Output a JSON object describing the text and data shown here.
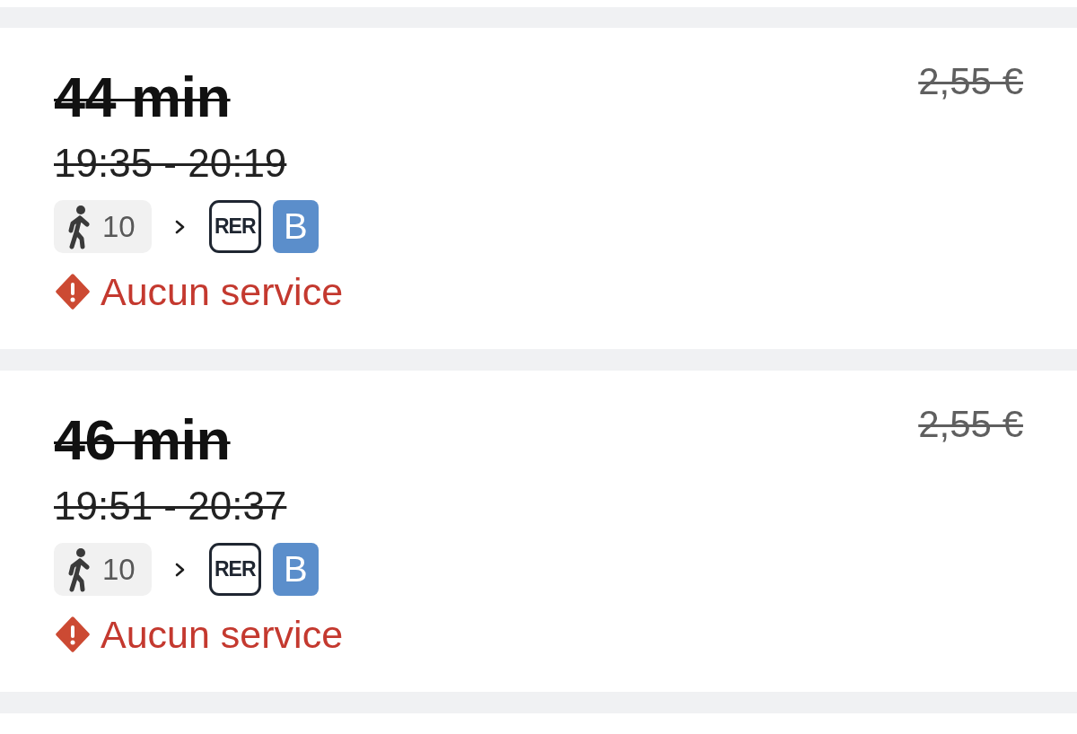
{
  "journeys": [
    {
      "duration": "44 min",
      "times": "19:35 - 20:19",
      "price": "2,55 €",
      "cancelled": true,
      "legs": [
        {
          "kind": "walk",
          "label": "10"
        },
        {
          "kind": "transit",
          "mode": "RER",
          "line": "B",
          "color": "#5b8ecb"
        }
      ],
      "alert": "Aucun service"
    },
    {
      "duration": "46 min",
      "times": "19:51 - 20:37",
      "price": "2,55 €",
      "cancelled": true,
      "legs": [
        {
          "kind": "walk",
          "label": "10"
        },
        {
          "kind": "transit",
          "mode": "RER",
          "line": "B",
          "color": "#5b8ecb"
        }
      ],
      "alert": "Aucun service"
    }
  ]
}
